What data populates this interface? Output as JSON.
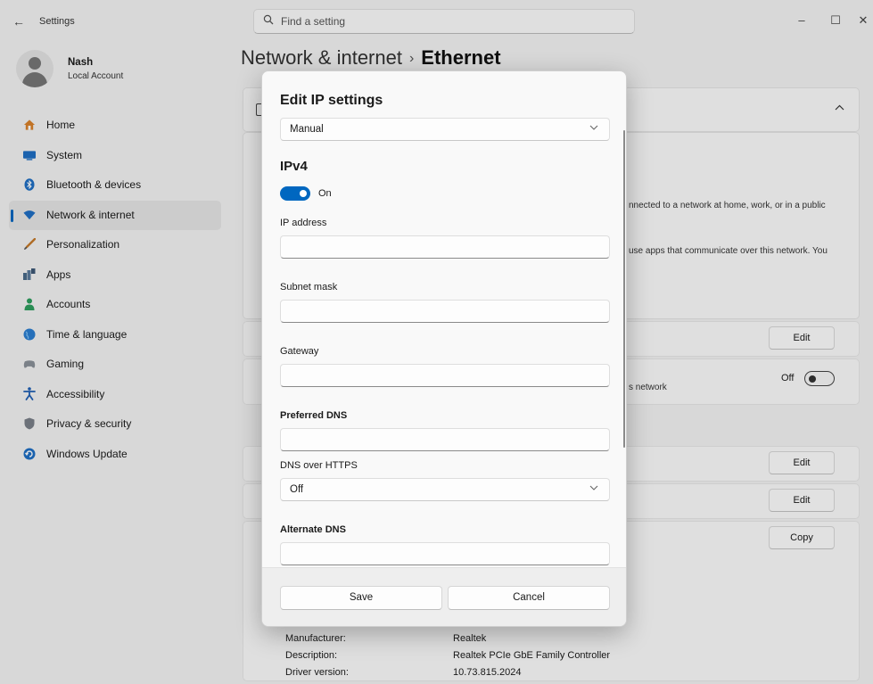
{
  "window": {
    "app_title": "Settings",
    "search_placeholder": "Find a setting",
    "controls": {
      "minimize": "–",
      "maximize": "☐",
      "close": "✕"
    }
  },
  "profile": {
    "name": "Nash",
    "account_type": "Local Account"
  },
  "sidebar": {
    "items": [
      {
        "label": "Home",
        "icon": "home-icon",
        "active": false
      },
      {
        "label": "System",
        "icon": "system-icon",
        "active": false
      },
      {
        "label": "Bluetooth & devices",
        "icon": "bluetooth-icon",
        "active": false
      },
      {
        "label": "Network & internet",
        "icon": "wifi-icon",
        "active": true
      },
      {
        "label": "Personalization",
        "icon": "brush-icon",
        "active": false
      },
      {
        "label": "Apps",
        "icon": "apps-icon",
        "active": false
      },
      {
        "label": "Accounts",
        "icon": "person-icon",
        "active": false
      },
      {
        "label": "Time & language",
        "icon": "globe-clock-icon",
        "active": false
      },
      {
        "label": "Gaming",
        "icon": "gamepad-icon",
        "active": false
      },
      {
        "label": "Accessibility",
        "icon": "accessibility-icon",
        "active": false
      },
      {
        "label": "Privacy & security",
        "icon": "shield-icon",
        "active": false
      },
      {
        "label": "Windows Update",
        "icon": "update-icon",
        "active": false
      }
    ]
  },
  "header": {
    "breadcrumb_parent": "Network & internet",
    "separator": "›",
    "current": "Ethernet"
  },
  "background": {
    "text_public": "nnected to a network at home, work, or in a public",
    "text_apps": "use apps that communicate over this network. You",
    "text_network": "s network",
    "edit_label": "Edit",
    "off_label": "Off",
    "copy_label": "Copy",
    "properties": [
      {
        "key": "Manufacturer:",
        "value": "Realtek"
      },
      {
        "key": "Description:",
        "value": "Realtek PCIe GbE Family Controller"
      },
      {
        "key": "Driver version:",
        "value": "10.73.815.2024"
      }
    ]
  },
  "dialog": {
    "title": "Edit IP settings",
    "mode_value": "Manual",
    "ipv4_title": "IPv4",
    "ipv4_toggle_label": "On",
    "ip_address_label": "IP address",
    "subnet_mask_label": "Subnet mask",
    "gateway_label": "Gateway",
    "preferred_dns_label": "Preferred DNS",
    "dns_over_https_label": "DNS over HTTPS",
    "dns_over_https_value": "Off",
    "alternate_dns_label": "Alternate DNS",
    "save_label": "Save",
    "cancel_label": "Cancel"
  },
  "colors": {
    "accent": "#0067c0",
    "window_bg": "#f3f3f3",
    "dialog_bg": "#f9f9f9"
  }
}
